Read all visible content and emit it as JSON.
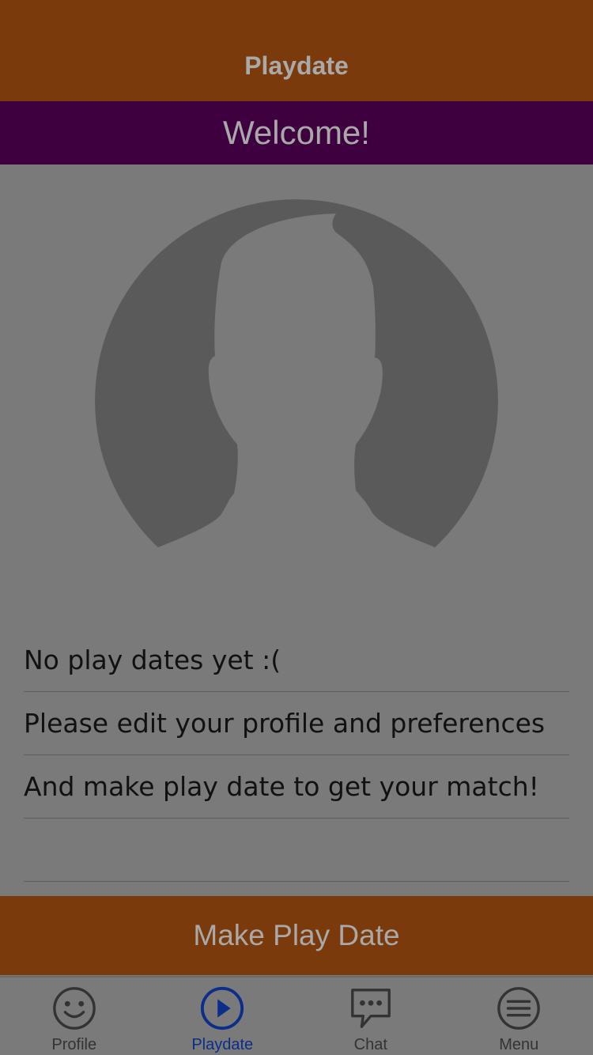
{
  "header": {
    "title": "Playdate"
  },
  "banner": {
    "text": "Welcome!"
  },
  "info_lines": [
    "No play dates yet :(",
    "Please edit your profile and preferences",
    "And make play date to get your match!",
    ""
  ],
  "action_button": {
    "label": "Make Play Date"
  },
  "tabs": [
    {
      "label": "Profile",
      "icon": "smiley-icon",
      "active": false
    },
    {
      "label": "Playdate",
      "icon": "play-circle-icon",
      "active": true
    },
    {
      "label": "Chat",
      "icon": "chat-bubble-icon",
      "active": false
    },
    {
      "label": "Menu",
      "icon": "menu-icon",
      "active": false
    }
  ],
  "colors": {
    "header_bg": "#7a3a0b",
    "banner_bg": "#3f0040",
    "active_tab": "#0a2e8a",
    "dim_overlay_bg": "#7a7a7a"
  }
}
